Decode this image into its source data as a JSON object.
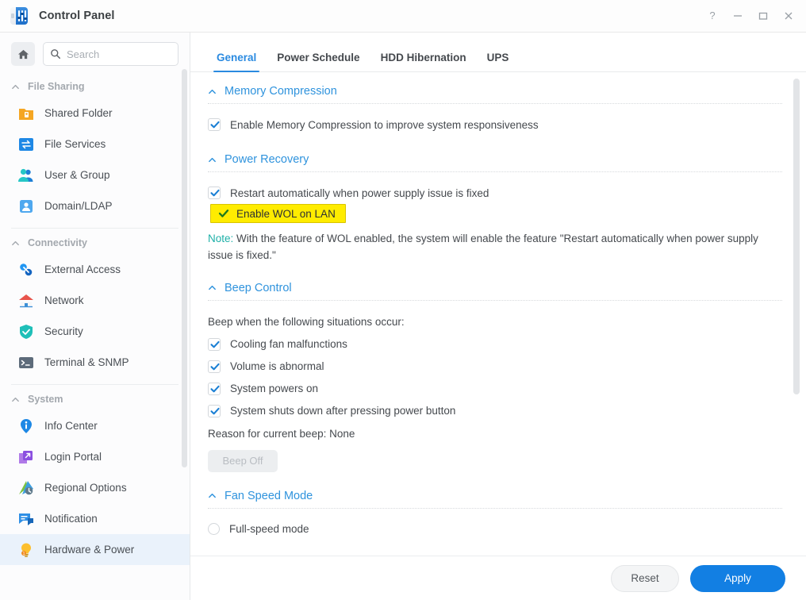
{
  "window": {
    "title": "Control Panel",
    "app_icon": "control-panel-icon",
    "controls": [
      {
        "name": "help-button",
        "glyph": "?"
      },
      {
        "name": "minimize-button",
        "glyph": "—"
      },
      {
        "name": "maximize-button",
        "glyph": "▭"
      },
      {
        "name": "close-button",
        "glyph": "✕"
      }
    ]
  },
  "sidebar": {
    "home_icon": "home-icon",
    "search": {
      "placeholder": "Search",
      "value": "",
      "icon": "search-icon"
    },
    "groups": [
      {
        "title": "File Sharing",
        "caret": "chevron-up-icon",
        "items": [
          {
            "label": "Shared Folder",
            "icon": "shared-folder-icon",
            "active": false
          },
          {
            "label": "File Services",
            "icon": "file-services-icon",
            "active": false
          },
          {
            "label": "User & Group",
            "icon": "user-group-icon",
            "active": false
          },
          {
            "label": "Domain/LDAP",
            "icon": "domain-ldap-icon",
            "active": false
          }
        ]
      },
      {
        "title": "Connectivity",
        "caret": "chevron-up-icon",
        "items": [
          {
            "label": "External Access",
            "icon": "external-access-icon",
            "active": false
          },
          {
            "label": "Network",
            "icon": "network-icon",
            "active": false
          },
          {
            "label": "Security",
            "icon": "security-icon",
            "active": false
          },
          {
            "label": "Terminal & SNMP",
            "icon": "terminal-snmp-icon",
            "active": false
          }
        ]
      },
      {
        "title": "System",
        "caret": "chevron-up-icon",
        "items": [
          {
            "label": "Info Center",
            "icon": "info-center-icon",
            "active": false
          },
          {
            "label": "Login Portal",
            "icon": "login-portal-icon",
            "active": false
          },
          {
            "label": "Regional Options",
            "icon": "regional-options-icon",
            "active": false
          },
          {
            "label": "Notification",
            "icon": "notification-icon",
            "active": false
          },
          {
            "label": "Hardware & Power",
            "icon": "hardware-power-icon",
            "active": true
          }
        ]
      }
    ]
  },
  "tabs": [
    {
      "label": "General",
      "active": true
    },
    {
      "label": "Power Schedule",
      "active": false
    },
    {
      "label": "HDD Hibernation",
      "active": false
    },
    {
      "label": "UPS",
      "active": false
    }
  ],
  "sections": {
    "memory_compression": {
      "title": "Memory Compression",
      "checkbox": {
        "label": "Enable Memory Compression to improve system responsiveness",
        "checked": true
      }
    },
    "power_recovery": {
      "title": "Power Recovery",
      "restart": {
        "label": "Restart automatically when power supply issue is fixed",
        "checked": true
      },
      "wol": {
        "label": "Enable WOL on LAN",
        "checked": true,
        "highlighted": true
      },
      "note_label": "Note:",
      "note_text": " With the feature of WOL enabled, the system will enable the feature \"Restart automatically when power supply issue is fixed.\""
    },
    "beep_control": {
      "title": "Beep Control",
      "intro": "Beep when the following situations occur:",
      "checkboxes": [
        {
          "label": "Cooling fan malfunctions",
          "checked": true
        },
        {
          "label": "Volume is abnormal",
          "checked": true
        },
        {
          "label": "System powers on",
          "checked": true
        },
        {
          "label": "System shuts down after pressing power button",
          "checked": true
        }
      ],
      "reason": "Reason for current beep: None",
      "beep_off_button": "Beep Off"
    },
    "fan_speed_mode": {
      "title": "Fan Speed Mode",
      "options": [
        {
          "label": "Full-speed mode",
          "selected": false
        }
      ]
    }
  },
  "footer": {
    "reset_label": "Reset",
    "apply_label": "Apply"
  },
  "colors": {
    "accent": "#2a8ae0",
    "primary_button": "#127fe3",
    "section_header": "#2f93dd",
    "highlight": "#ffec00",
    "highlight_border": "#d9c400",
    "note_label": "#1eb0a8",
    "selected_nav": "#eaf2fb"
  }
}
